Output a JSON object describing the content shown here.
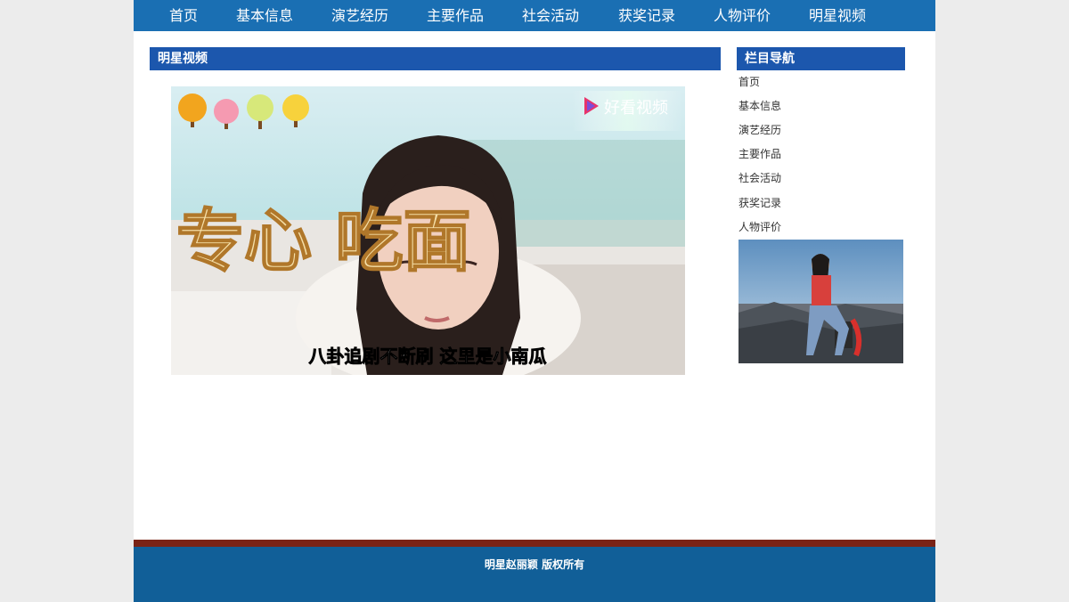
{
  "nav": {
    "items": [
      "首页",
      "基本信息",
      "演艺经历",
      "主要作品",
      "社会活动",
      "获奖记录",
      "人物评价",
      "明星视频"
    ]
  },
  "main": {
    "section_title": "明星视频",
    "video": {
      "brand_label": "好看视频",
      "caption_large": "专心  吃面",
      "subtitle": "八卦追剧不断刷 这里是小南瓜"
    }
  },
  "sidebar": {
    "title": "栏目导航",
    "items": [
      "首页",
      "基本信息",
      "演艺经历",
      "主要作品",
      "社会活动",
      "获奖记录",
      "人物评价"
    ]
  },
  "footer": {
    "text": "明星赵丽颖 版权所有"
  },
  "colors": {
    "nav_bg": "#1a6fb3",
    "section_bar": "#1c57ad",
    "footer_bg": "#115f98",
    "footer_line": "#7a2316"
  }
}
